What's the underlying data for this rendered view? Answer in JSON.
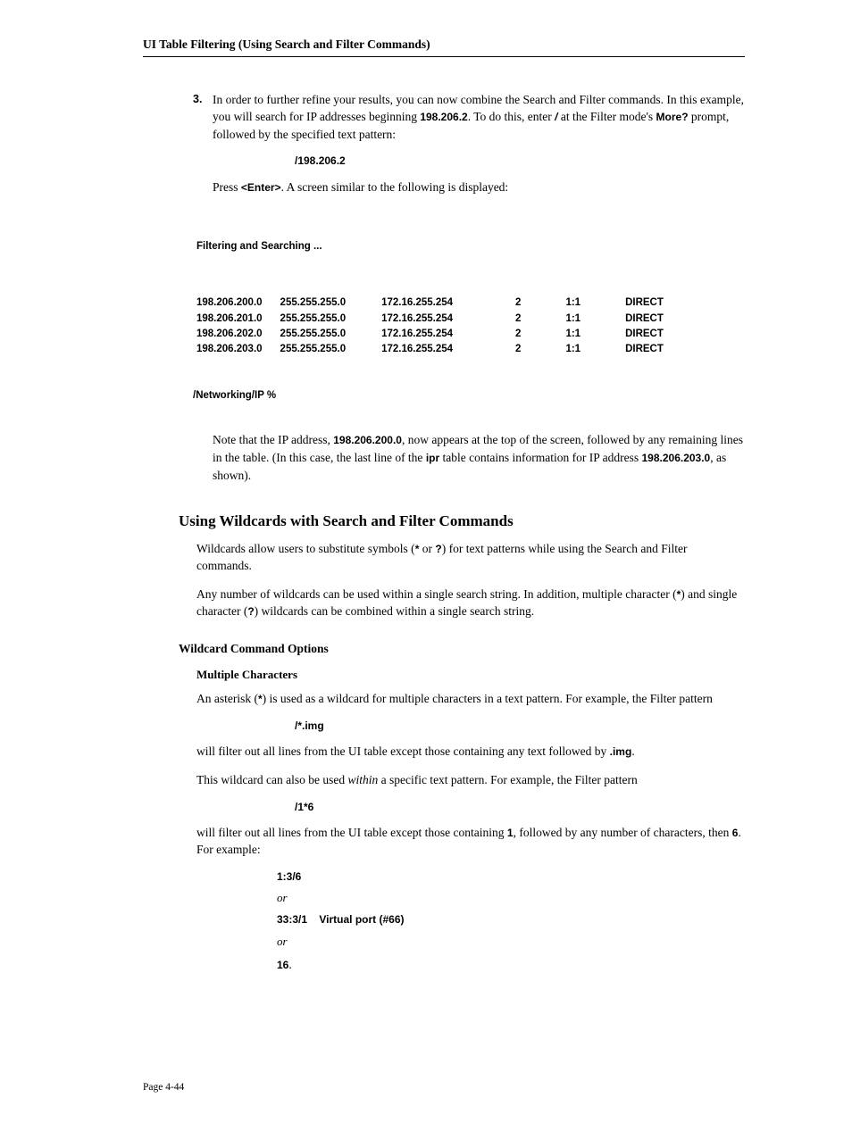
{
  "header": "UI Table Filtering (Using Search and Filter Commands)",
  "step3": {
    "num": "3.",
    "p1a": "In order to further refine your results, you can now combine the Search and Filter commands. In this example, you will search for IP addresses beginning ",
    "p1b": "198.206.2",
    "p1c": ". To do this, enter ",
    "p1d": "/",
    "p1e": " at the Filter mode's ",
    "p1f": "More?",
    "p1g": " prompt, followed by the specified text pattern:",
    "cmd": "/198.206.2",
    "p2a": "Press ",
    "p2b": "<Enter>",
    "p2c": ".  A screen similar to the following is displayed:"
  },
  "filtering_label": "Filtering and Searching ...",
  "routes": [
    {
      "net": "198.206.200.0",
      "mask": "255.255.255.0",
      "gw": "172.16.255.254",
      "m": "2",
      "r": "1:1",
      "t": "DIRECT"
    },
    {
      "net": "198.206.201.0",
      "mask": "255.255.255.0",
      "gw": "172.16.255.254",
      "m": "2",
      "r": "1:1",
      "t": "DIRECT"
    },
    {
      "net": "198.206.202.0",
      "mask": "255.255.255.0",
      "gw": "172.16.255.254",
      "m": "2",
      "r": "1:1",
      "t": "DIRECT"
    },
    {
      "net": "198.206.203.0",
      "mask": "255.255.255.0",
      "gw": "172.16.255.254",
      "m": "2",
      "r": "1:1",
      "t": "DIRECT"
    }
  ],
  "prompt_line": "/Networking/IP %",
  "note": {
    "a": "Note that the IP address, ",
    "b": "198.206.200.0",
    "c": ", now appears at the top of the screen, followed by any remaining lines in the table. (In this case, the last line of the ",
    "d": "ipr",
    "e": " table contains information for IP address ",
    "f": "198.206.203.0",
    "g": ", as shown)."
  },
  "h2": "Using Wildcards with Search and Filter Commands",
  "wc_p1a": "Wildcards allow users to substitute symbols (",
  "wc_p1b": "*",
  "wc_p1c": " or ",
  "wc_p1d": "?",
  "wc_p1e": ") for text patterns while using the Search and Filter commands.",
  "wc_p2a": "Any number of wildcards can be used within a single search string. In addition, multiple character (",
  "wc_p2b": "*",
  "wc_p2c": ") and single character (",
  "wc_p2d": "?",
  "wc_p2e": ") wildcards can be combined within a single search string.",
  "h3": "Wildcard Command Options",
  "h4": "Multiple Characters",
  "mc_p1a": "An asterisk (",
  "mc_p1b": "*",
  "mc_p1c": ") is used as a wildcard for multiple characters in a text pattern. For example, the Filter pattern",
  "mc_cmd1": "/*.img",
  "mc_p2a": "will filter out all lines from the UI table except those containing any text followed by ",
  "mc_p2b": ".img",
  "mc_p2c": ".",
  "mc_p3a": "This wildcard can also be used ",
  "mc_p3b": "within",
  "mc_p3c": " a specific text pattern. For example, the Filter pattern",
  "mc_cmd2": "/1*6",
  "mc_p4a": "will filter out all lines from the UI table except those containing ",
  "mc_p4b": "1",
  "mc_p4c": ", followed by any number of characters, then ",
  "mc_p4d": "6",
  "mc_p4e": ". For example:",
  "ex": {
    "l1": "1:3/6",
    "or": "or",
    "l2a": "33:3/1",
    "l2b": "Virtual port (#66)",
    "l3": "16",
    "dot": "."
  },
  "footer": "Page 4-44"
}
